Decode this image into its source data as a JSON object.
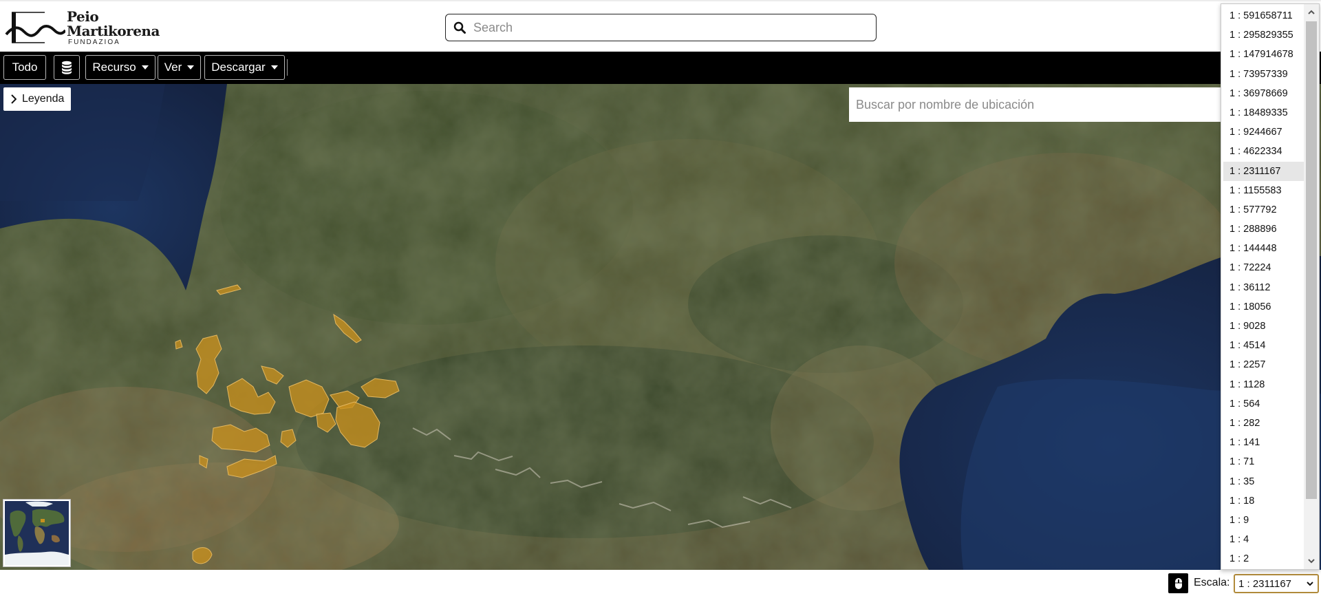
{
  "header": {
    "logo": {
      "line1": "Peio",
      "line2": "Martikorena",
      "subtitle": "FUNDAZIOA"
    },
    "search_placeholder": "Search"
  },
  "toolbar": {
    "all_label": "Todo",
    "resource_label": "Recurso",
    "view_label": "Ver",
    "download_label": "Descargar"
  },
  "map": {
    "legend_label": "Leyenda",
    "location_search_placeholder": "Buscar por nombre de ubicación"
  },
  "scale": {
    "label": "Escala:",
    "selected": "1 : 2311167",
    "options": [
      "1 : 591658711",
      "1 : 295829355",
      "1 : 147914678",
      "1 : 73957339",
      "1 : 36978669",
      "1 : 18489335",
      "1 : 9244667",
      "1 : 4622334",
      "1 : 2311167",
      "1 : 1155583",
      "1 : 577792",
      "1 : 288896",
      "1 : 144448",
      "1 : 72224",
      "1 : 36112",
      "1 : 18056",
      "1 : 9028",
      "1 : 4514",
      "1 : 2257",
      "1 : 1128",
      "1 : 564",
      "1 : 282",
      "1 : 141",
      "1 : 71",
      "1 : 35",
      "1 : 18",
      "1 : 9",
      "1 : 4",
      "1 : 2"
    ],
    "selected_index": 8
  },
  "icons": {
    "search": "search-icon",
    "layers": "database-icon",
    "legend": "chevron-right-icon",
    "mouse": "mouse-icon"
  },
  "colors": {
    "toolbar_bg": "#000000",
    "highlight_overlay": "#c8901e",
    "sea": "#1b2b4a"
  }
}
